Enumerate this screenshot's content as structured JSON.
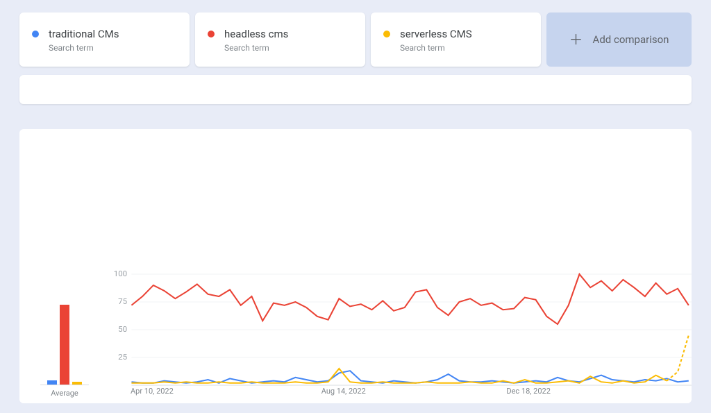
{
  "terms": [
    {
      "label": "traditional CMs",
      "sub": "Search term",
      "color": "#4285f4"
    },
    {
      "label": "headless cms",
      "sub": "Search term",
      "color": "#ea4335"
    },
    {
      "label": "serverless CMS",
      "sub": "Search term",
      "color": "#fbbc04"
    }
  ],
  "add_label": "Add comparison",
  "avg_label": "Average",
  "chart_data": {
    "type": "line",
    "ylim": [
      0,
      100
    ],
    "yticks": [
      25,
      50,
      75,
      100
    ],
    "xticks": [
      {
        "label": "Apr 10, 2022",
        "frac": 0.0
      },
      {
        "label": "Aug 14, 2022",
        "frac": 0.34
      },
      {
        "label": "Dec 18, 2022",
        "frac": 0.67
      }
    ],
    "averages": [
      {
        "name": "traditional CMs",
        "value": 4,
        "color": "#4285f4"
      },
      {
        "name": "headless cms",
        "value": 77,
        "color": "#ea4335"
      },
      {
        "name": "serverless CMS",
        "value": 3,
        "color": "#fbbc04"
      }
    ],
    "x_index": [
      0,
      1,
      2,
      3,
      4,
      5,
      6,
      7,
      8,
      9,
      10,
      11,
      12,
      13,
      14,
      15,
      16,
      17,
      18,
      19,
      20,
      21,
      22,
      23,
      24,
      25,
      26,
      27,
      28,
      29,
      30,
      31,
      32,
      33,
      34,
      35,
      36,
      37,
      38,
      39,
      40,
      41,
      42,
      43,
      44,
      45,
      46,
      47,
      48,
      49,
      50,
      51
    ],
    "series": [
      {
        "name": "traditional CMs",
        "color": "#4285f4",
        "values": [
          3,
          2,
          2,
          4,
          3,
          2,
          3,
          5,
          2,
          6,
          4,
          2,
          3,
          4,
          3,
          7,
          5,
          3,
          4,
          11,
          13,
          4,
          3,
          2,
          4,
          3,
          2,
          3,
          5,
          10,
          4,
          3,
          3,
          4,
          3,
          2,
          3,
          4,
          3,
          7,
          4,
          3,
          6,
          9,
          5,
          4,
          3,
          5,
          4,
          6,
          3,
          4
        ]
      },
      {
        "name": "headless cms",
        "color": "#ea4335",
        "values": [
          72,
          80,
          90,
          85,
          78,
          84,
          91,
          82,
          80,
          86,
          72,
          80,
          58,
          74,
          72,
          75,
          70,
          62,
          59,
          78,
          71,
          73,
          68,
          76,
          67,
          70,
          84,
          86,
          70,
          63,
          75,
          78,
          72,
          74,
          68,
          69,
          79,
          77,
          62,
          55,
          72,
          100,
          88,
          94,
          85,
          95,
          88,
          80,
          92,
          82,
          87,
          72
        ]
      },
      {
        "name": "serverless CMS",
        "color": "#fbbc04",
        "values": [
          2,
          2,
          2,
          3,
          2,
          3,
          2,
          2,
          3,
          2,
          2,
          3,
          2,
          2,
          2,
          3,
          2,
          2,
          3,
          15,
          3,
          2,
          2,
          3,
          2,
          2,
          2,
          3,
          2,
          2,
          2,
          3,
          2,
          2,
          4,
          2,
          5,
          2,
          2,
          3,
          4,
          2,
          8,
          3,
          2,
          4,
          2,
          3,
          9,
          4,
          12,
          45
        ],
        "dashed_from_index": 49
      }
    ]
  }
}
